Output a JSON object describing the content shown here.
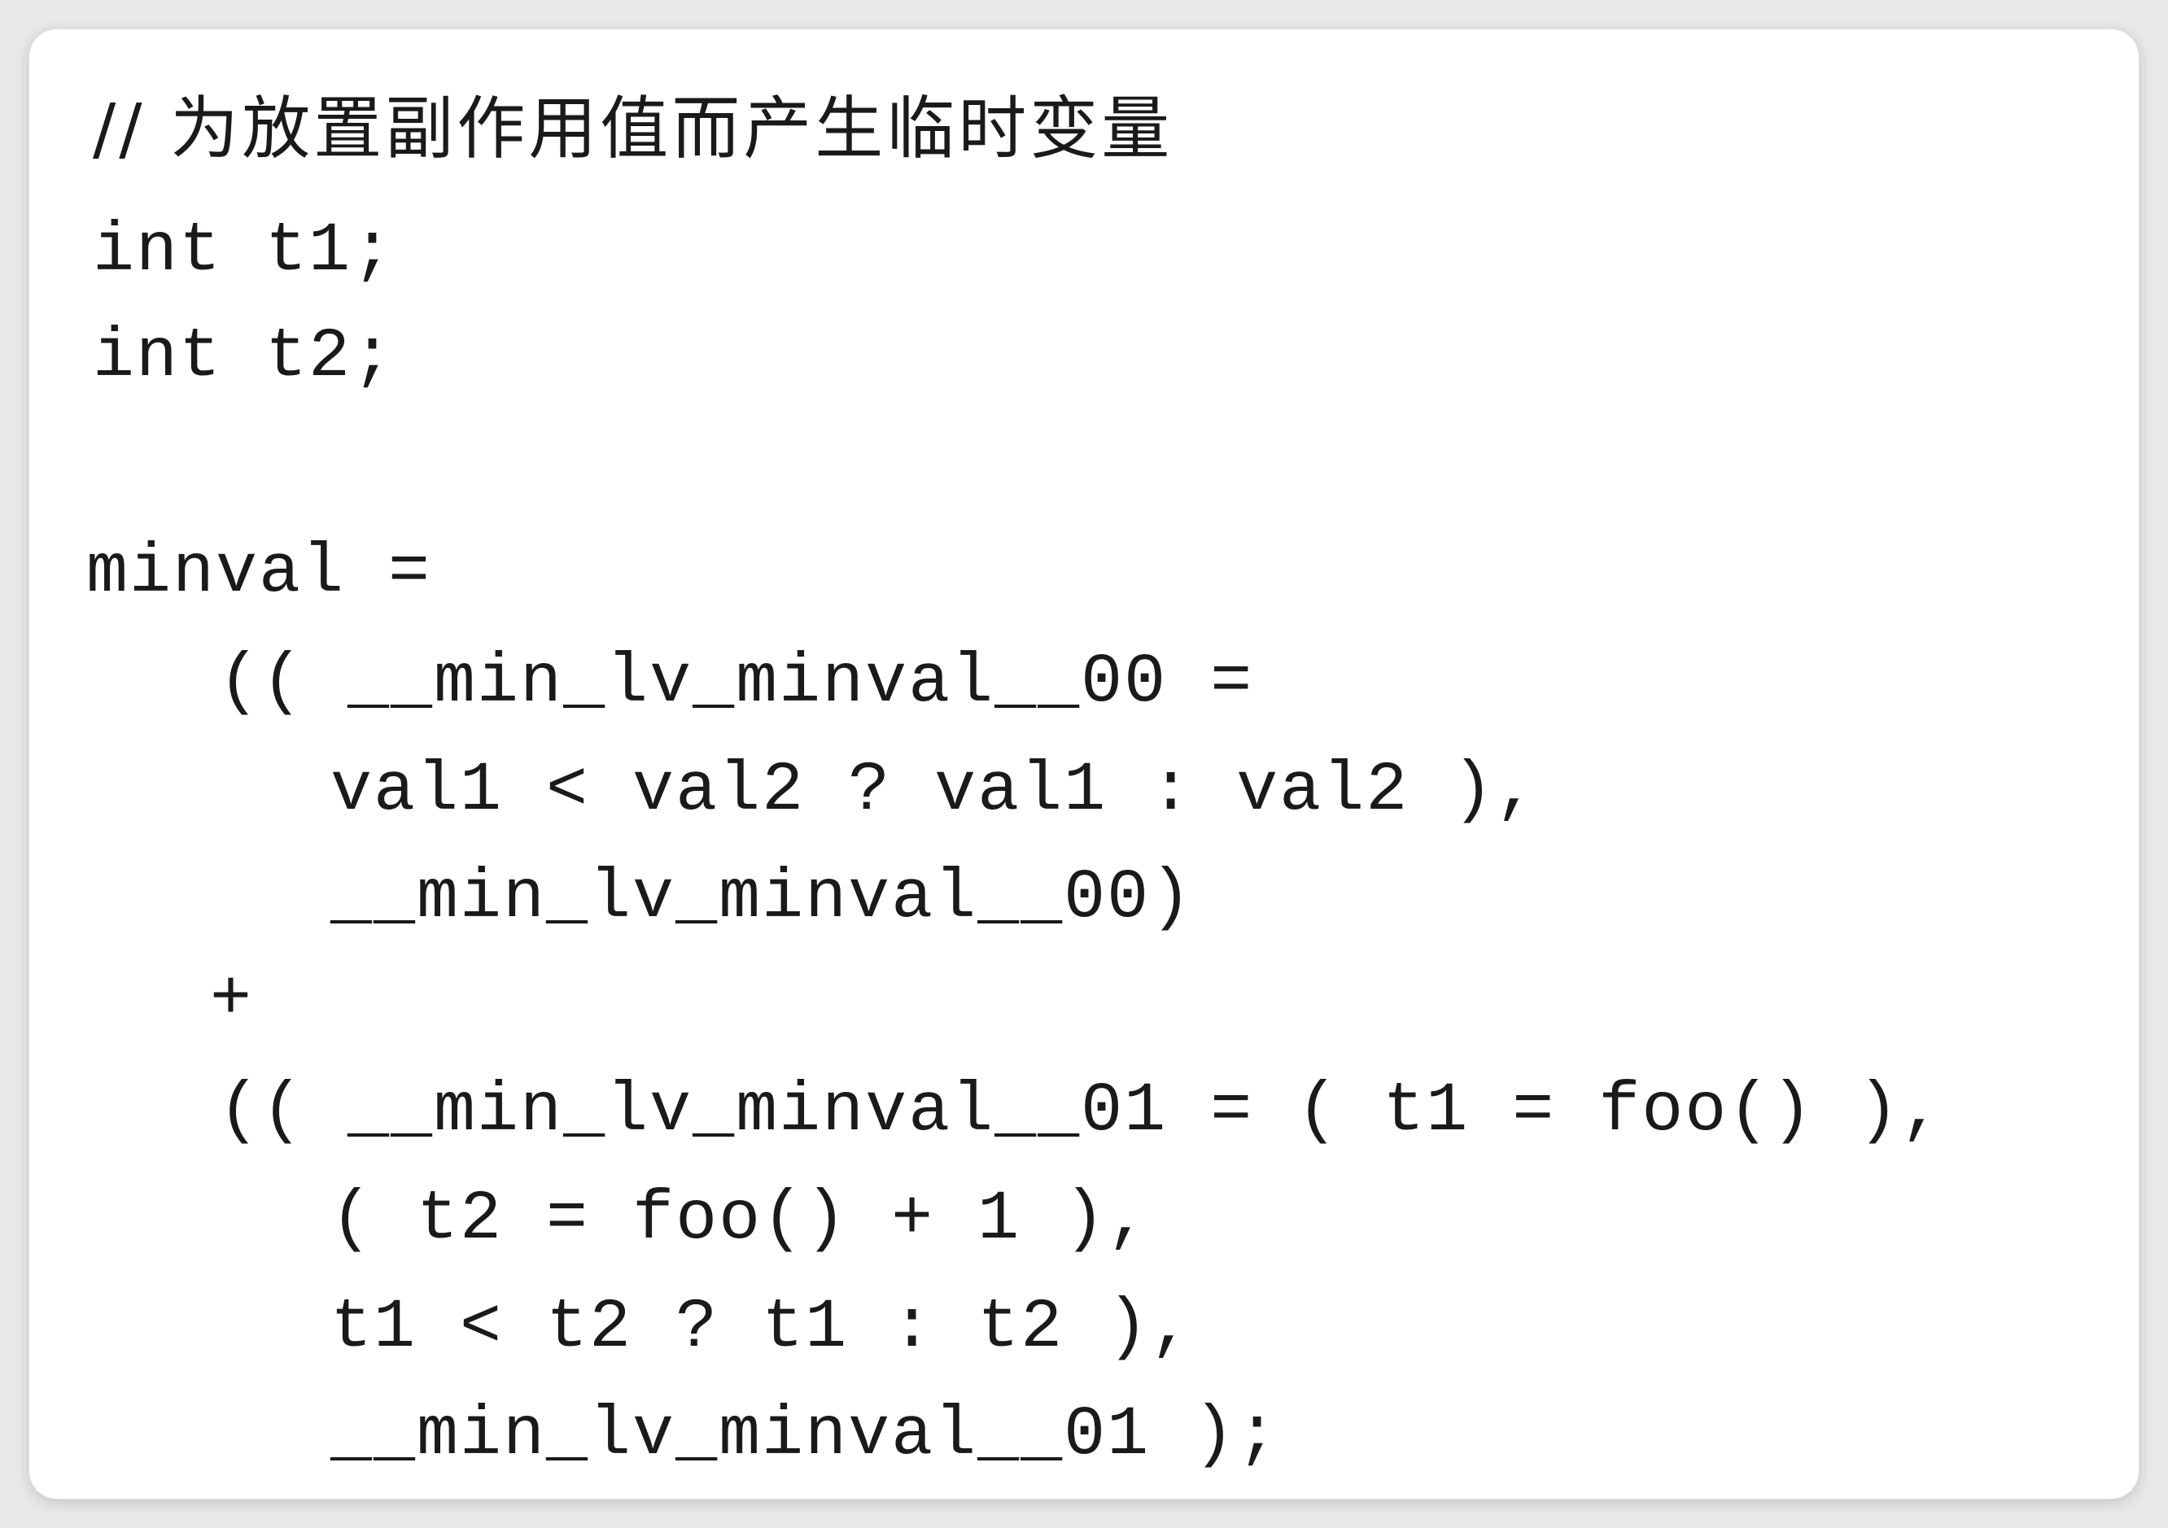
{
  "code": {
    "lines": [
      "// 为放置副作用值而产生临时变量",
      "int t1;",
      "int t2;",
      "minval =",
      "(( __min_lv_minval__00 =",
      "val1 < val2 ? val1 : val2 ),",
      "__min_lv_minval__00)",
      "+",
      "(( __min_lv_minval__01 = ( t1 = foo() ),",
      "( t2 = foo() + 1 ),",
      "t1 < t2 ? t1 : t2 ),",
      "__min_lv_minval__01 );"
    ]
  }
}
